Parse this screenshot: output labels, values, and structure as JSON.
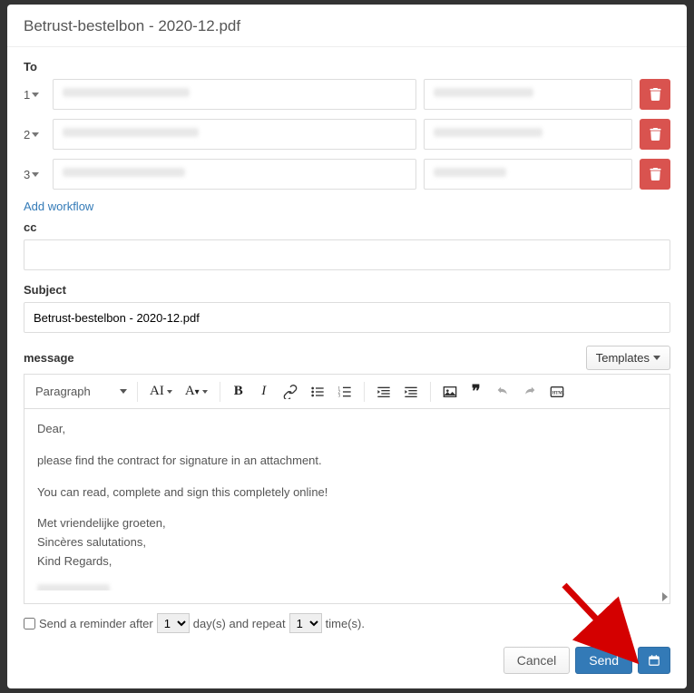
{
  "title": "Betrust-bestelbon - 2020-12.pdf",
  "labels": {
    "to": "To",
    "cc": "cc",
    "subject": "Subject",
    "message": "message"
  },
  "recipients": [
    {
      "order": "1"
    },
    {
      "order": "2"
    },
    {
      "order": "3"
    }
  ],
  "add_workflow": "Add workflow",
  "subject_value": "Betrust-bestelbon - 2020-12.pdf",
  "templates_label": "Templates",
  "paragraph_label": "Paragraph",
  "editor": {
    "greeting": "Dear,",
    "line1": "please find the contract for signature in an attachment.",
    "line2": "You can read, complete and sign this completely online!",
    "sig1": "Met vriendelijke groeten,",
    "sig2": "Sincères salutations,",
    "sig3": "Kind Regards,"
  },
  "reminder": {
    "text1": "Send a reminder after",
    "days_value": "1",
    "text2": "day(s) and repeat",
    "repeat_value": "1",
    "text3": "time(s)."
  },
  "footer": {
    "cancel": "Cancel",
    "send": "Send"
  }
}
